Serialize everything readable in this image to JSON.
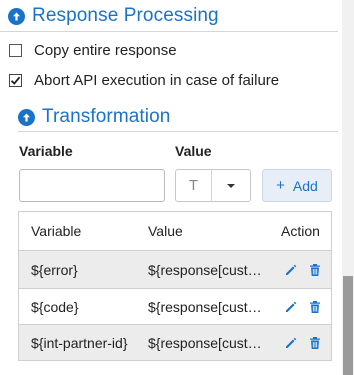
{
  "response_processing": {
    "title": "Response Processing",
    "copy_entire_response": {
      "label": "Copy entire response",
      "checked": false
    },
    "abort_on_failure": {
      "label": "Abort API execution in case of failure",
      "checked": true
    }
  },
  "transformation": {
    "title": "Transformation",
    "variable_label": "Variable",
    "value_label": "Value",
    "variable_input_value": "",
    "type_value": "T",
    "add_label": "Add",
    "table": {
      "headers": {
        "variable": "Variable",
        "value": "Value",
        "action": "Action"
      },
      "rows": [
        {
          "variable": "${error}",
          "value": "${response[custo…"
        },
        {
          "variable": "${code}",
          "value": "${response[custo…"
        },
        {
          "variable": "${int-partner-id}",
          "value": "${response[custo…"
        }
      ]
    }
  },
  "colors": {
    "accent": "#1a73c8",
    "row_shade": "#ececec"
  },
  "icons": [
    "arrow-up-circle",
    "check",
    "caret-down",
    "plus",
    "pencil",
    "trash"
  ]
}
